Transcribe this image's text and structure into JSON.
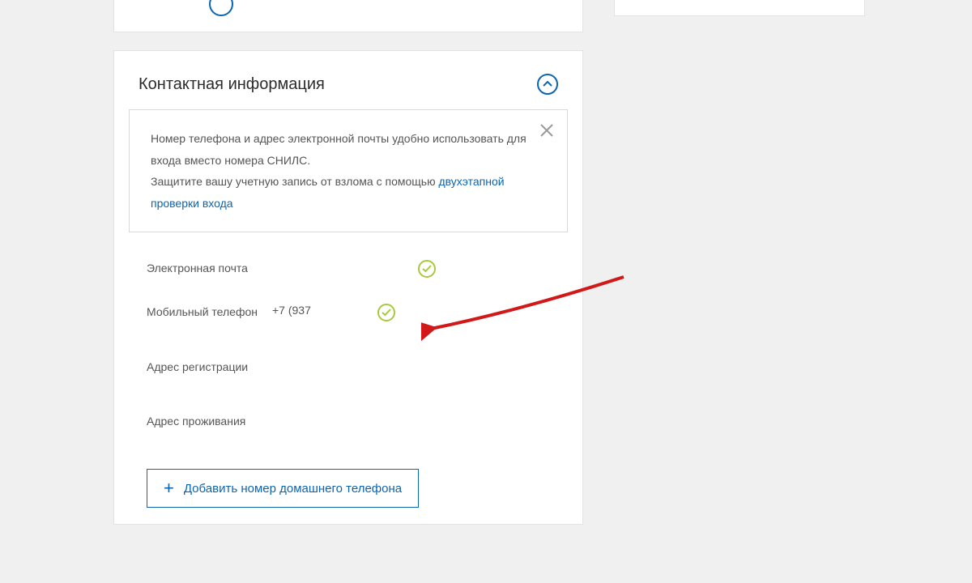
{
  "section": {
    "title": "Контактная информация"
  },
  "hint": {
    "text1": "Номер телефона и адрес электронной почты удобно использовать для входа вместо номера СНИЛС.",
    "text2": "Защитите вашу учетную запись от взлома с помощью ",
    "link": "двухэтапной проверки входа"
  },
  "fields": {
    "email": {
      "label": "Электронная почта",
      "value": ""
    },
    "mobile": {
      "label": "Мобильный телефон",
      "value": "+7 (937"
    },
    "reg_addr": {
      "label": "Адрес регистрации",
      "value": ""
    },
    "live_addr": {
      "label": "Адрес проживания",
      "value": ""
    }
  },
  "add_button": {
    "label": "Добавить номер домашнего телефона"
  }
}
